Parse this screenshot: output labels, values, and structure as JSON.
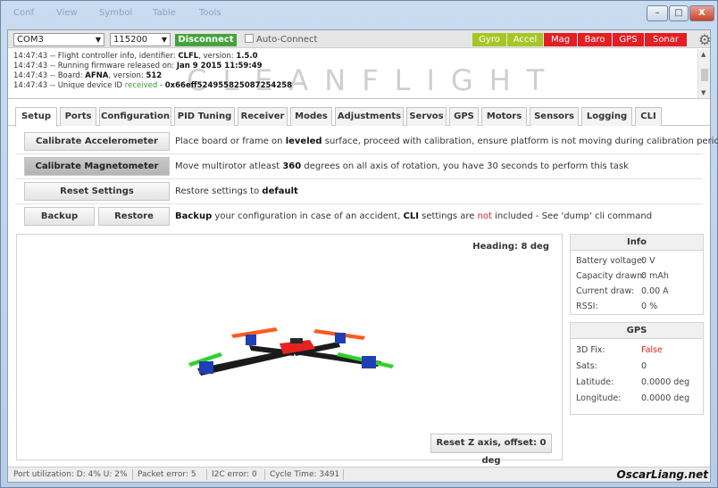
{
  "window": {
    "menus": [
      "Conf",
      "View",
      "Symbol",
      "Table",
      "Tools"
    ],
    "minimize": "–",
    "maximize": "□",
    "close": "X"
  },
  "topbar": {
    "port": "COM3",
    "baud": "115200",
    "disconnect": "Disconnect",
    "auto_connect": "Auto-Connect",
    "sensors": [
      {
        "label": "Gyro",
        "color": "#a8c526"
      },
      {
        "label": "Accel",
        "color": "#a8c526"
      },
      {
        "label": "Mag",
        "color": "#e31e24"
      },
      {
        "label": "Baro",
        "color": "#e31e24"
      },
      {
        "label": "GPS",
        "color": "#e31e24"
      },
      {
        "label": "Sonar",
        "color": "#e31e24"
      }
    ]
  },
  "log": {
    "lines": [
      {
        "prefix": "14:47:43 -- Flight controller info, identifier: ",
        "b1": "CLFL",
        "mid": ", version: ",
        "b2": "1.5.0"
      },
      {
        "prefix": "14:47:43 -- Running firmware released on: ",
        "b1": "Jan 9 2015 11:59:49",
        "mid": "",
        "b2": ""
      },
      {
        "prefix": "14:47:43 -- Board: ",
        "b1": "AFNA",
        "mid": ", version: ",
        "b2": "512"
      },
      {
        "prefix": "14:47:43 -- Unique device ID ",
        "g": "received",
        "mid": " - ",
        "b2": "0x66eff524955825087254258"
      }
    ],
    "watermark": "CLEANFLIGHT"
  },
  "tabs": [
    "Setup",
    "Ports",
    "Configuration",
    "PID Tuning",
    "Receiver",
    "Modes",
    "Adjustments",
    "Servos",
    "GPS",
    "Motors",
    "Sensors",
    "Logging",
    "CLI"
  ],
  "setup": {
    "calibrate_acc": "Calibrate Accelerometer",
    "calibrate_acc_desc": {
      "pre": "Place board or frame on ",
      "b": "leveled",
      "post": " surface, proceed with calibration, ensure platform is not moving during calibration period"
    },
    "calibrate_mag": "Calibrate Magnetometer",
    "calibrate_mag_desc": {
      "pre": "Move multirotor atleast ",
      "b": "360",
      "post": " degrees on all axis of rotation, you have 30 seconds to perform this task"
    },
    "reset": "Reset Settings",
    "reset_desc": {
      "pre": "Restore settings to ",
      "b": "default",
      "post": ""
    },
    "backup": "Backup",
    "restore": "Restore",
    "backup_desc": {
      "b1": "Backup",
      "t1": " your configuration in case of an accident, ",
      "b2": "CLI",
      "t2": " settings are ",
      "red": "not",
      "t3": " included - See 'dump' cli command"
    },
    "heading": "Heading: 8 deg",
    "reset_z": "Reset Z axis, offset: 0 deg"
  },
  "info": {
    "title": "Info",
    "rows": [
      {
        "label": "Battery voltage:",
        "value": "0 V"
      },
      {
        "label": "Capacity drawn:",
        "value": "0 mAh"
      },
      {
        "label": "Current draw:",
        "value": "0.00 A"
      },
      {
        "label": "RSSI:",
        "value": "0 %"
      }
    ]
  },
  "gps": {
    "title": "GPS",
    "rows": [
      {
        "label": "3D Fix:",
        "value": "False"
      },
      {
        "label": "Sats:",
        "value": "0"
      },
      {
        "label": "Latitude:",
        "value": "0.0000 deg"
      },
      {
        "label": "Longitude:",
        "value": "0.0000 deg"
      }
    ]
  },
  "status": {
    "port_util": "Port utilization: D: 4% U: 2%",
    "packet_error": "Packet error: 5",
    "i2c_error": "I2C error: 0",
    "cycle_time": "Cycle Time: 3491",
    "credit": "OscarLiang.net"
  }
}
